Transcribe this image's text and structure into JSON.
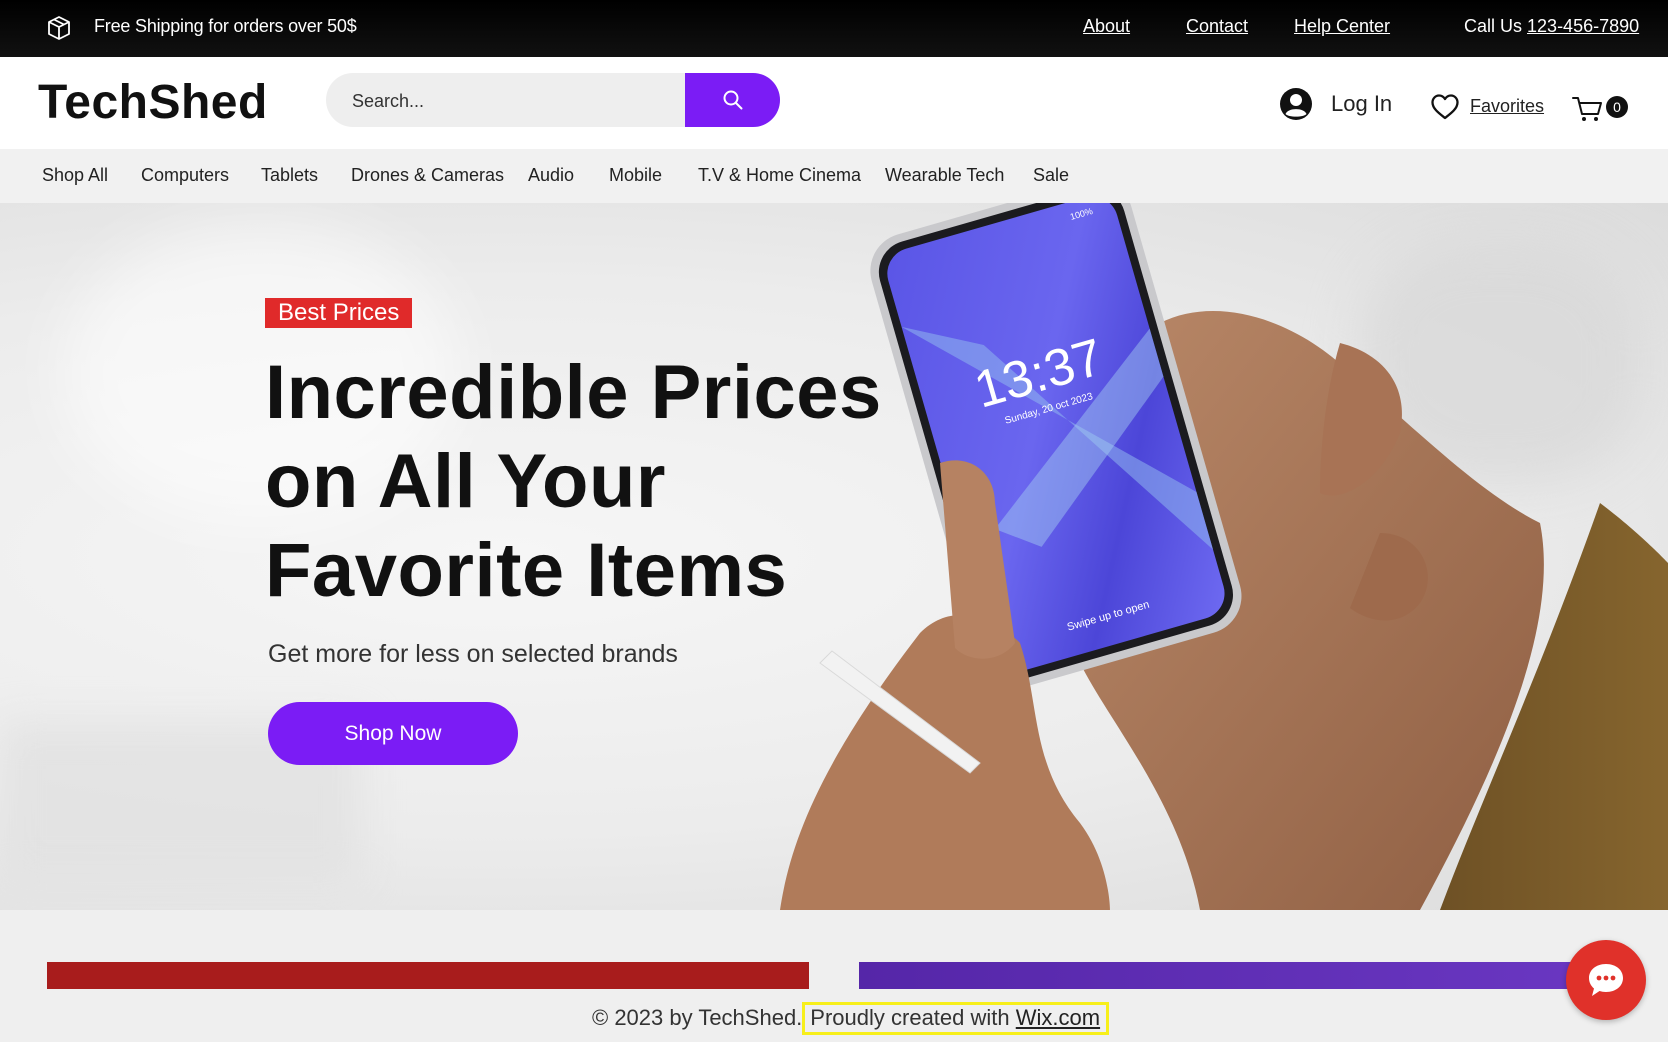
{
  "topbar": {
    "shipping_text": "Free Shipping for orders over 50$",
    "links": {
      "about": "About",
      "contact": "Contact",
      "help": "Help Center"
    },
    "call_prefix": "Call Us",
    "phone": "123-456-7890"
  },
  "header": {
    "logo": "TechShed",
    "search_placeholder": "Search...",
    "login_label": "Log In",
    "favorites_label": "Favorites",
    "cart_count": "0"
  },
  "nav": {
    "items": [
      "Shop All",
      "Computers",
      "Tablets",
      "Drones & Cameras",
      "Audio",
      "Mobile",
      "T.V & Home Cinema",
      "Wearable Tech",
      "Sale"
    ]
  },
  "hero": {
    "badge": "Best Prices",
    "headline_lines": [
      "Incredible Prices",
      "on All Your",
      "Favorite Items"
    ],
    "subheadline": "Get more for less on selected brands",
    "cta": "Shop Now",
    "phone_screen": {
      "time": "13:37",
      "date": "Sunday, 20 oct 2023",
      "battery": "100%",
      "swipe": "Swipe up to open"
    }
  },
  "footer": {
    "copyright": "© 2023 by TechShed.",
    "created_with": "Proudly created with",
    "wix_link": "Wix.com"
  },
  "colors": {
    "accent": "#7b1cf5",
    "badge_red": "#e02a2a",
    "bar_red": "#a81c1c",
    "bar_purple": "#5526a8",
    "highlight": "#f7ef1a",
    "chat": "#e0312a"
  },
  "icons": [
    "box-icon",
    "search-icon",
    "user-icon",
    "heart-icon",
    "cart-icon",
    "chat-icon"
  ]
}
